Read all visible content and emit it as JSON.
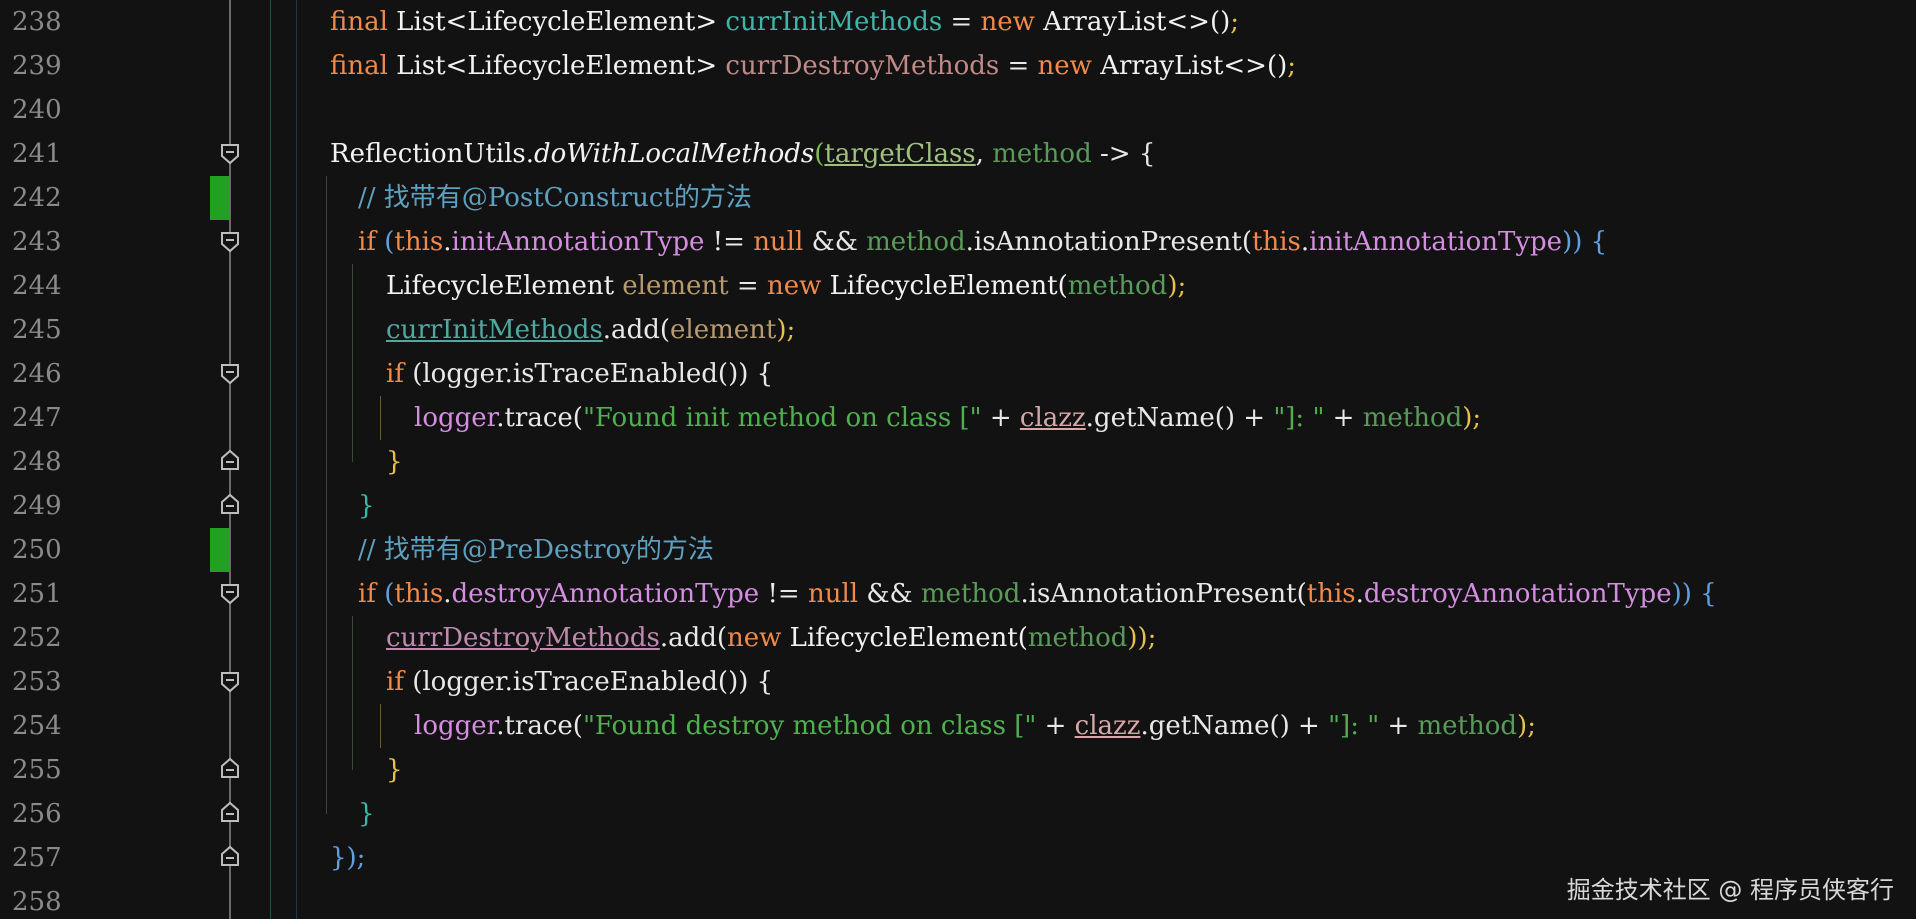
{
  "lines": [
    {
      "num": "238"
    },
    {
      "num": "239"
    },
    {
      "num": "240"
    },
    {
      "num": "241"
    },
    {
      "num": "242"
    },
    {
      "num": "243"
    },
    {
      "num": "244"
    },
    {
      "num": "245"
    },
    {
      "num": "246"
    },
    {
      "num": "247"
    },
    {
      "num": "248"
    },
    {
      "num": "249"
    },
    {
      "num": "250"
    },
    {
      "num": "251"
    },
    {
      "num": "252"
    },
    {
      "num": "253"
    },
    {
      "num": "254"
    },
    {
      "num": "255"
    },
    {
      "num": "256"
    },
    {
      "num": "257"
    },
    {
      "num": "258"
    }
  ],
  "code": {
    "l238": {
      "kw": "final",
      "type": "List<LifecycleElement>",
      "var": "currInitMethods",
      "rest": " = ",
      "new": "new",
      "ctor": "ArrayList<>()",
      "end": ";"
    },
    "l239": {
      "kw": "final",
      "type": "List<LifecycleElement>",
      "var": "currDestroyMethods",
      "rest": " = ",
      "new": "new",
      "ctor": "ArrayList<>()",
      "end": ";"
    },
    "l241": {
      "cls": "ReflectionUtils.",
      "method": "doWithLocalMethods",
      "arg1": "targetClass",
      "arg2": "method",
      "arrow": " -> {"
    },
    "l242": {
      "comment": "// 找带有@PostConstruct的方法"
    },
    "l243": {
      "if": "if",
      "this": "this",
      "field": "initAnnotationType",
      "cmp": " != ",
      "null": "null",
      "and": " && ",
      "m": "method",
      "call": ".isAnnotationPresent(",
      "this2": "this",
      "field2": "initAnnotationType",
      "close": ")) {"
    },
    "l244": {
      "type": "LifecycleElement",
      "var": "element",
      "eq": " = ",
      "new": "new",
      "ctor": "LifecycleElement(",
      "arg": "method",
      "end": ");"
    },
    "l245": {
      "field": "currInitMethods",
      "call": ".add(",
      "arg": "element",
      "end": ");"
    },
    "l246": {
      "if": "if",
      "text": "(logger.isTraceEnabled()) {"
    },
    "l247": {
      "obj": "logger",
      "call": ".trace(",
      "str": "\"Found init method on class [\"",
      "plus": " + ",
      "clazz": "clazz",
      "gn": ".getName()",
      "plus2": " + ",
      "str2": "\"]: \"",
      "plus3": " + ",
      "m": "method",
      "end": ");"
    },
    "l248": {
      "brace": "}"
    },
    "l249": {
      "brace": "}"
    },
    "l250": {
      "comment": "// 找带有@PreDestroy的方法"
    },
    "l251": {
      "if": "if",
      "this": "this",
      "field": "destroyAnnotationType",
      "cmp": " != ",
      "null": "null",
      "and": " && ",
      "m": "method",
      "call": ".isAnnotationPresent(",
      "this2": "this",
      "field2": "destroyAnnotationType",
      "close": ")) {"
    },
    "l252": {
      "field": "currDestroyMethods",
      "call": ".add(",
      "new": "new",
      "ctor": "LifecycleElement(",
      "arg": "method",
      "end": "));"
    },
    "l253": {
      "if": "if",
      "text": "(logger.isTraceEnabled()) {"
    },
    "l254": {
      "obj": "logger",
      "call": ".trace(",
      "str": "\"Found destroy method on class [\"",
      "plus": " + ",
      "clazz": "clazz",
      "gn": ".getName()",
      "plus2": " + ",
      "str2": "\"]: \"",
      "plus3": " + ",
      "m": "method",
      "end": ");"
    },
    "l255": {
      "brace": "}"
    },
    "l256": {
      "brace": "}"
    },
    "l257": {
      "brace": "});"
    }
  },
  "watermark": "掘金技术社区 @ 程序员侠客行"
}
